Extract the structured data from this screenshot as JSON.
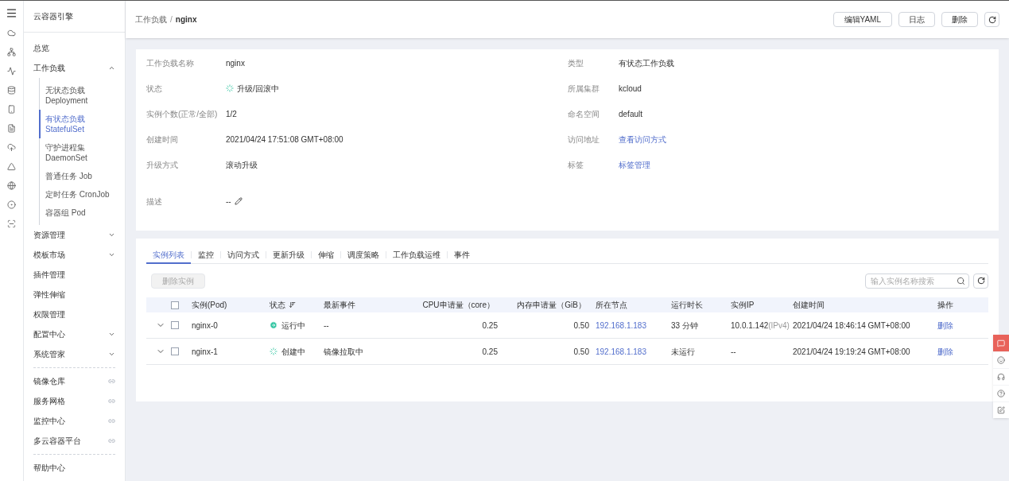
{
  "sidebar": {
    "title": "云容器引擎",
    "items": [
      {
        "kind": "item",
        "label": "总览"
      },
      {
        "kind": "group",
        "label": "工作负载",
        "expanded": true,
        "children": [
          {
            "label": "无状态负载",
            "sub": "Deployment",
            "selected": false
          },
          {
            "label": "有状态负载",
            "sub": "StatefulSet",
            "selected": true
          },
          {
            "label": "守护进程集",
            "sub": "DaemonSet",
            "selected": false
          },
          {
            "label": "普通任务 Job",
            "selected": false
          },
          {
            "label": "定时任务 CronJob",
            "selected": false
          },
          {
            "label": "容器组 Pod",
            "selected": false
          }
        ]
      },
      {
        "kind": "group",
        "label": "资源管理",
        "expanded": false
      },
      {
        "kind": "group",
        "label": "模板市场",
        "expanded": false
      },
      {
        "kind": "item",
        "label": "插件管理"
      },
      {
        "kind": "item",
        "label": "弹性伸缩"
      },
      {
        "kind": "item",
        "label": "权限管理"
      },
      {
        "kind": "group",
        "label": "配置中心",
        "expanded": false
      },
      {
        "kind": "group",
        "label": "系统管家",
        "expanded": false
      },
      {
        "kind": "divider"
      },
      {
        "kind": "link",
        "label": "镜像仓库"
      },
      {
        "kind": "link",
        "label": "服务网格"
      },
      {
        "kind": "link",
        "label": "监控中心"
      },
      {
        "kind": "link",
        "label": "多云容器平台"
      },
      {
        "kind": "divider"
      },
      {
        "kind": "item",
        "label": "帮助中心"
      }
    ]
  },
  "breadcrumb": {
    "parent": "工作负载",
    "separator": "/",
    "current": "nginx"
  },
  "header_buttons": [
    "编辑YAML",
    "日志",
    "删除"
  ],
  "details": {
    "left": [
      {
        "label": "工作负载名称",
        "kind": "text",
        "value": "nginx"
      },
      {
        "label": "状态",
        "kind": "status",
        "value": "升级/回滚中"
      },
      {
        "label": "实例个数(正常/全部)",
        "kind": "text",
        "value": "1/2"
      },
      {
        "label": "创建时间",
        "kind": "text",
        "value": "2021/04/24 17:51:08 GMT+08:00"
      },
      {
        "label": "升级方式",
        "kind": "text",
        "value": "滚动升级"
      },
      {
        "label": "描述",
        "kind": "edit",
        "value": "--"
      }
    ],
    "right": [
      {
        "label": "类型",
        "kind": "text",
        "value": "有状态工作负载"
      },
      {
        "label": "所属集群",
        "kind": "text",
        "value": "kcloud"
      },
      {
        "label": "命名空间",
        "kind": "text",
        "value": "default"
      },
      {
        "label": "访问地址",
        "kind": "link",
        "value": "查看访问方式"
      },
      {
        "label": "标签",
        "kind": "link",
        "value": "标签管理"
      }
    ]
  },
  "tabs": [
    {
      "label": "实例列表",
      "selected": true
    },
    {
      "label": "监控",
      "selected": false
    },
    {
      "label": "访问方式",
      "selected": false
    },
    {
      "label": "更新升级",
      "selected": false
    },
    {
      "label": "伸缩",
      "selected": false
    },
    {
      "label": "调度策略",
      "selected": false
    },
    {
      "label": "工作负载运维",
      "selected": false
    },
    {
      "label": "事件",
      "selected": false
    }
  ],
  "delete_instance_button": {
    "label": "删除实例",
    "disabled": true
  },
  "search": {
    "placeholder": "输入实例名称搜索"
  },
  "table": {
    "columns": [
      "实例(Pod)",
      "状态",
      "最新事件",
      "CPU申请量（core）",
      "内存申请量（GiB）",
      "所在节点",
      "运行时长",
      "实例IP",
      "创建时间",
      "操作"
    ],
    "select_all_checked": false,
    "rows": [
      {
        "pod": "nginx-0",
        "checked": false,
        "kind": "running",
        "status": "运行中",
        "event": "--",
        "cpu": "0.25",
        "memory": "0.50",
        "node": "192.168.1.183",
        "runtime": "33 分钟",
        "ip": "10.0.1.142",
        "ip_suffix": "(IPv4)",
        "created": "2021/04/24 18:46:14 GMT+08:00",
        "action": "删除"
      },
      {
        "pod": "nginx-1",
        "checked": false,
        "kind": "creating",
        "status": "创建中",
        "event": "镜像拉取中",
        "cpu": "0.25",
        "memory": "0.50",
        "node": "192.168.1.183",
        "runtime": "未运行",
        "ip": "--",
        "created": "2021/04/24 19:19:24 GMT+08:00",
        "action": "删除"
      }
    ]
  },
  "float_tools": [
    {
      "kind": "chat",
      "selected": true
    },
    {
      "kind": "face",
      "selected": false
    },
    {
      "kind": "headset",
      "selected": false
    },
    {
      "kind": "help",
      "selected": false
    },
    {
      "kind": "edit",
      "selected": false
    }
  ]
}
